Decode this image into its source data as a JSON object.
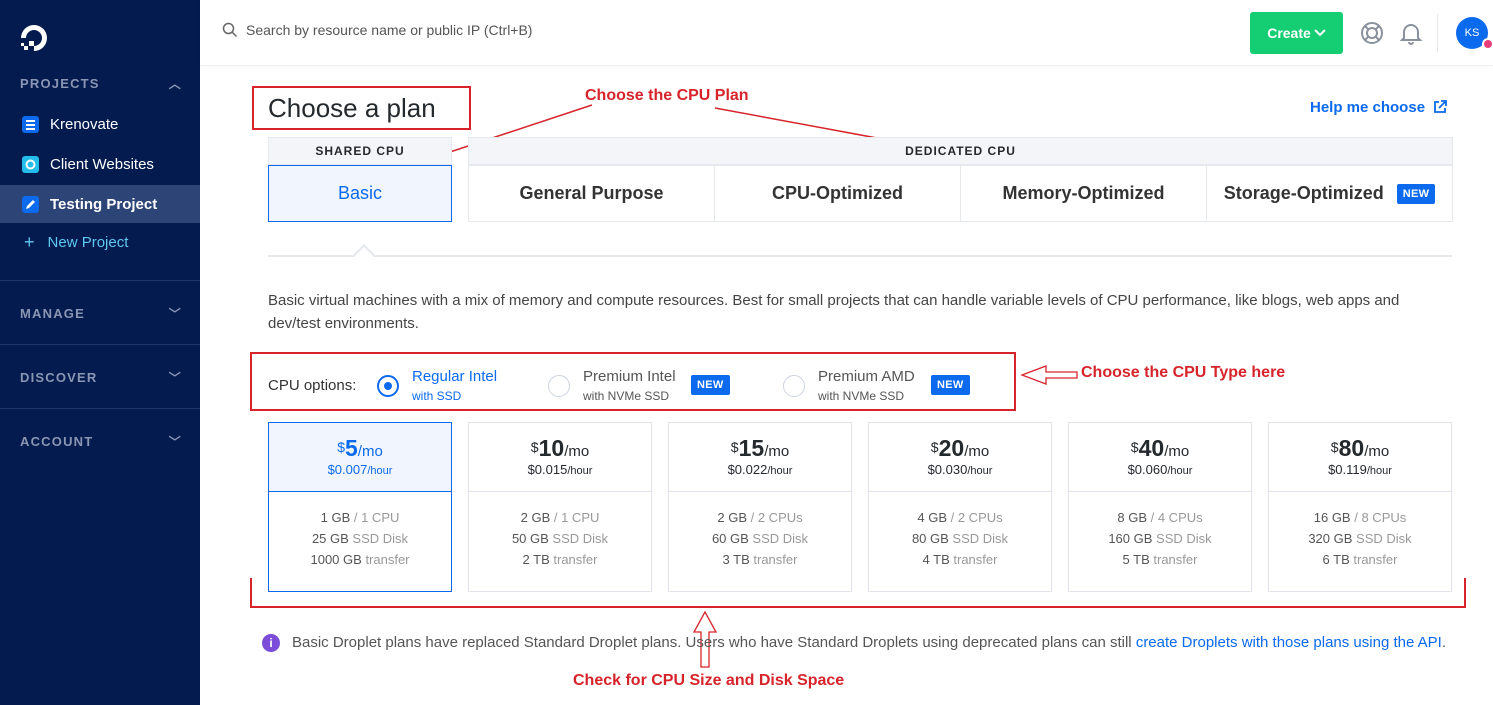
{
  "sidebar": {
    "projects_heading": "PROJECTS",
    "projects": [
      {
        "label": "Krenovate",
        "icon": "list-icon",
        "color": "#0b6aed"
      },
      {
        "label": "Client Websites",
        "icon": "circle-icon",
        "color": "#22bdea"
      },
      {
        "label": "Testing Project",
        "icon": "pencil-icon",
        "color": "#0b6aed"
      }
    ],
    "new_project": "New Project",
    "manage_heading": "MANAGE",
    "discover_heading": "DISCOVER",
    "account_heading": "ACCOUNT"
  },
  "topbar": {
    "search_placeholder": "Search by resource name or public IP (Ctrl+B)",
    "create_label": "Create",
    "avatar_initials": "KS"
  },
  "main": {
    "title": "Choose a plan",
    "help_link": "Help me choose",
    "shared_heading": "SHARED CPU",
    "dedicated_heading": "DEDICATED CPU",
    "tabs": [
      "Basic",
      "General Purpose",
      "CPU-Optimized",
      "Memory-Optimized",
      "Storage-Optimized"
    ],
    "new_badge": "NEW",
    "description": "Basic virtual machines with a mix of memory and compute resources. Best for small projects that can handle variable levels of CPU performance, like blogs, web apps and dev/test environments.",
    "cpu_options_label": "CPU options:",
    "cpu_options": [
      {
        "name": "Regular Intel",
        "sub": "with SSD"
      },
      {
        "name": "Premium Intel",
        "sub": "with NVMe SSD"
      },
      {
        "name": "Premium AMD",
        "sub": "with NVMe SSD"
      }
    ],
    "plans": [
      {
        "price": "5",
        "hourly": "$0.007",
        "mem": "1 GB",
        "cpu": "/ 1 CPU",
        "disk": "25 GB",
        "transfer": "1000 GB"
      },
      {
        "price": "10",
        "hourly": "$0.015",
        "mem": "2 GB",
        "cpu": "/ 1 CPU",
        "disk": "50 GB",
        "transfer": "2 TB"
      },
      {
        "price": "15",
        "hourly": "$0.022",
        "mem": "2 GB",
        "cpu": "/ 2 CPUs",
        "disk": "60 GB",
        "transfer": "3 TB"
      },
      {
        "price": "20",
        "hourly": "$0.030",
        "mem": "4 GB",
        "cpu": "/ 2 CPUs",
        "disk": "80 GB",
        "transfer": "4 TB"
      },
      {
        "price": "40",
        "hourly": "$0.060",
        "mem": "8 GB",
        "cpu": "/ 4 CPUs",
        "disk": "160 GB",
        "transfer": "5 TB"
      },
      {
        "price": "80",
        "hourly": "$0.119",
        "mem": "16 GB",
        "cpu": "/ 8 CPUs",
        "disk": "320 GB",
        "transfer": "6 TB"
      }
    ],
    "currency": "$",
    "per_month": "/mo",
    "per_hour": "/hour",
    "ssd_disk": "SSD Disk",
    "transfer_word": "transfer",
    "info_text": "Basic Droplet plans have replaced Standard Droplet plans. Users who have Standard Droplets using deprecated plans can still ",
    "info_link": "create Droplets with those plans using the API",
    "info_end": "."
  },
  "annotations": {
    "cpu_plan": "Choose the CPU Plan",
    "cpu_type": "Choose the CPU Type here",
    "cpu_size": "Check for CPU Size and Disk Space"
  },
  "colors": {
    "accent": "#0b6aed",
    "create": "#15cd72",
    "sidebar": "#031b4e",
    "annotation": "#d7242b"
  }
}
